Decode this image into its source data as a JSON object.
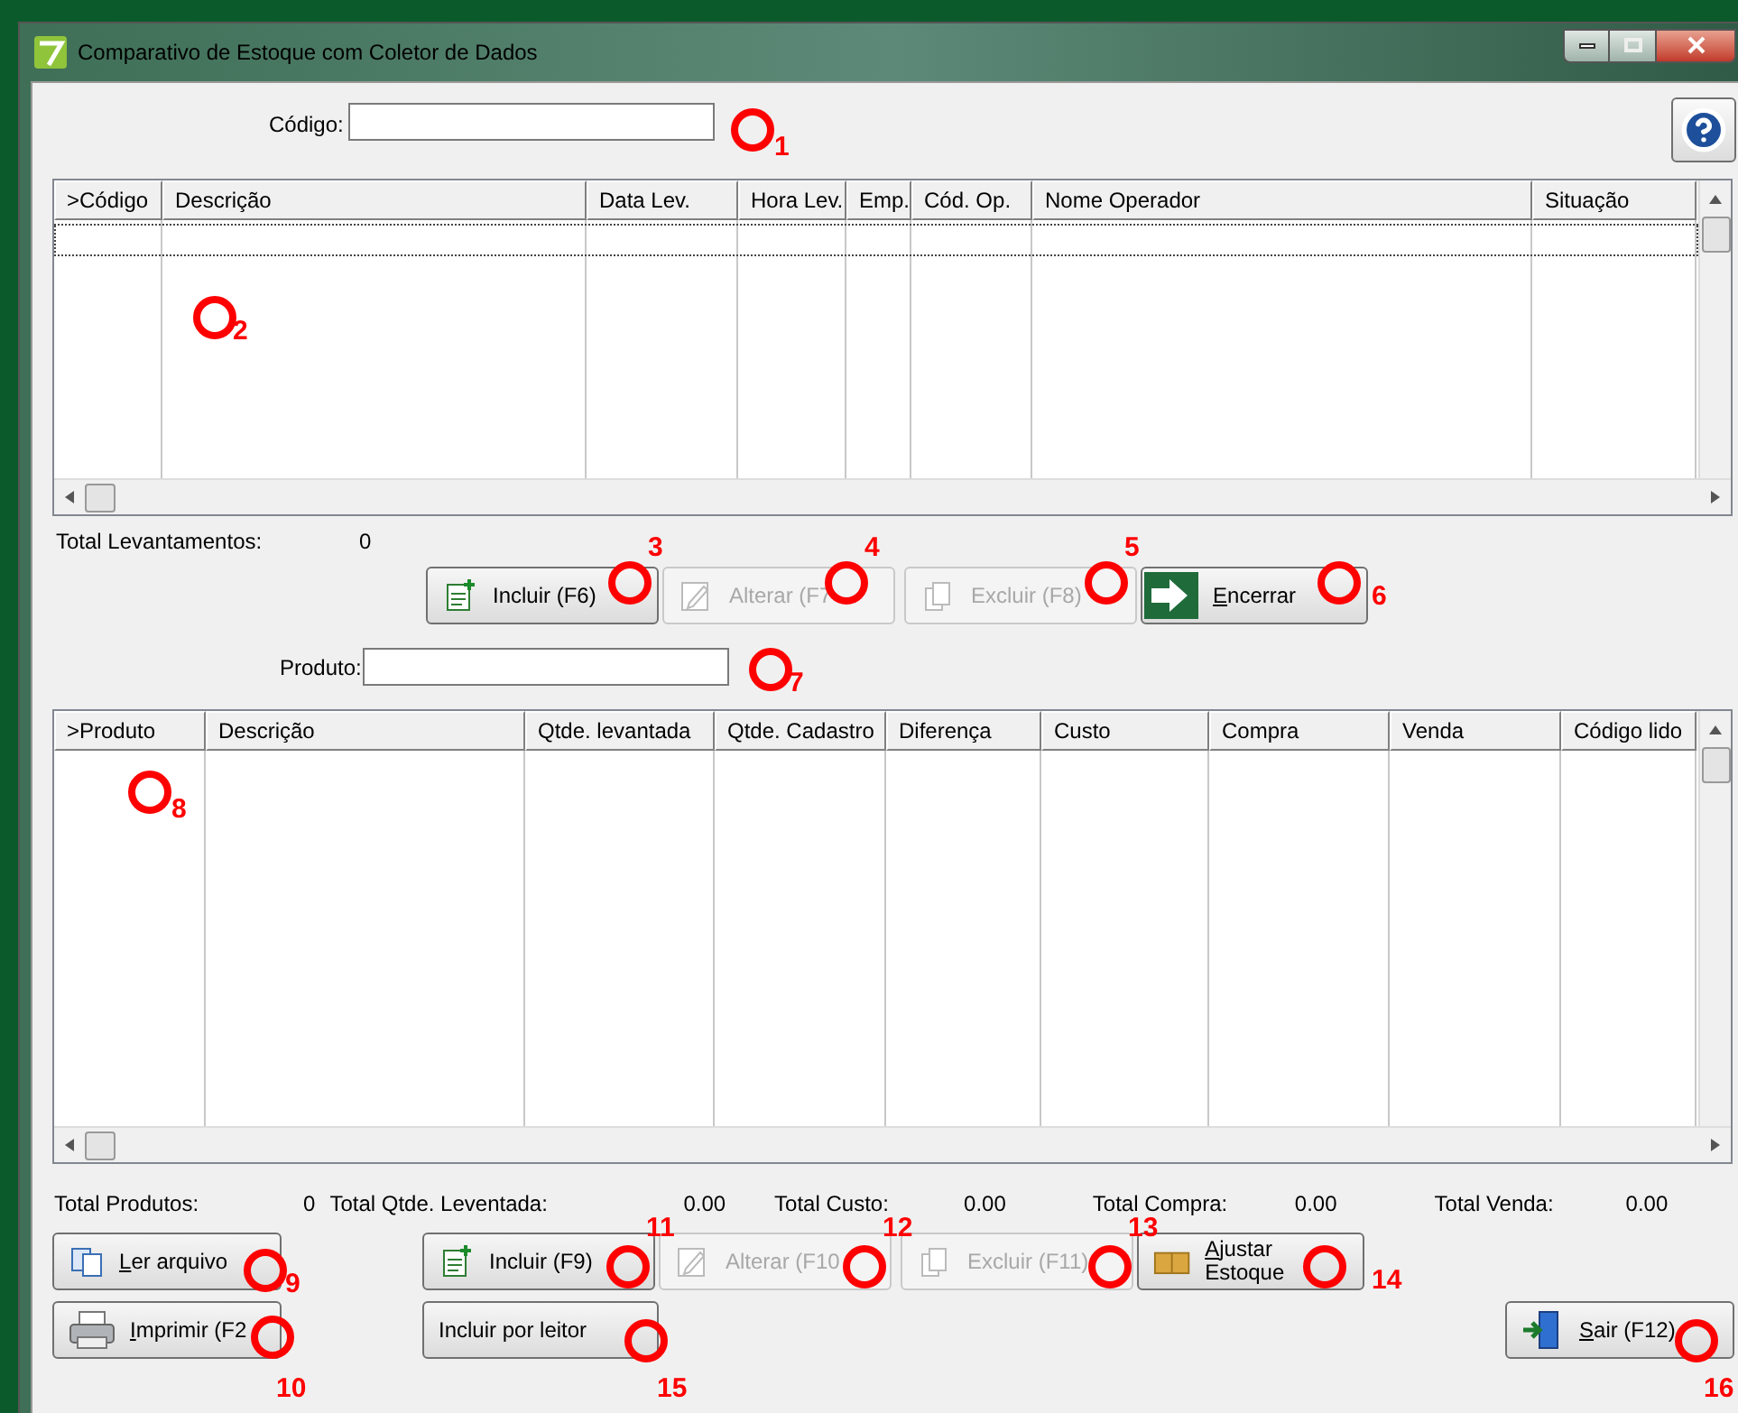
{
  "window": {
    "title": "Comparativo de Estoque com Coletor de Dados"
  },
  "codigo_field": {
    "label": "Código:"
  },
  "levantamentos_table": {
    "columns": [
      ">Código",
      "Descrição",
      "Data Lev.",
      "Hora Lev.",
      "Emp.",
      "Cód. Op.",
      "Nome Operador",
      "Situação"
    ]
  },
  "levantamentos_total": {
    "label": "Total Levantamentos:",
    "value": "0"
  },
  "levantamentos_buttons": [
    {
      "label": "Incluir (F6)",
      "disabled": false,
      "mnemonic": false
    },
    {
      "label": "Alterar (F7",
      "disabled": true,
      "mnemonic": false
    },
    {
      "label": "Excluir (F8)",
      "disabled": true,
      "mnemonic": false
    },
    {
      "label": "Encerrar",
      "disabled": false,
      "mnemonic": true
    }
  ],
  "produto_field": {
    "label": "Produto:"
  },
  "produtos_table": {
    "columns": [
      ">Produto",
      "Descrição",
      "Qtde. levantada",
      "Qtde. Cadastro",
      "Diferença",
      "Custo",
      "Compra",
      "Venda",
      "Código lido"
    ]
  },
  "totals": [
    {
      "label": "Total Produtos:",
      "value": "0"
    },
    {
      "label": "Total Qtde. Leventada:",
      "value": "0.00"
    },
    {
      "label": "Total Custo:",
      "value": "0.00"
    },
    {
      "label": "Total Compra:",
      "value": "0.00"
    },
    {
      "label": "Total Venda:",
      "value": "0.00"
    }
  ],
  "bottom_buttons": [
    {
      "label": "Ler arquivo",
      "disabled": false,
      "mnemonic": true
    },
    {
      "label": "Incluir (F9)",
      "disabled": false,
      "mnemonic": false
    },
    {
      "label": "Alterar (F10",
      "disabled": true,
      "mnemonic": false
    },
    {
      "label": "Excluir (F11)",
      "disabled": true,
      "mnemonic": false
    },
    {
      "label": "Ajustar Estoque",
      "disabled": false,
      "mnemonic": true
    },
    {
      "label": "Imprimir (F2",
      "disabled": false,
      "mnemonic": true
    },
    {
      "label": "Incluir por leitor",
      "disabled": false,
      "mnemonic": false
    },
    {
      "label": "Sair (F12)",
      "disabled": false,
      "mnemonic": true
    }
  ],
  "callouts": [
    {
      "label": "1"
    },
    {
      "label": "2"
    },
    {
      "label": "3"
    },
    {
      "label": "4"
    },
    {
      "label": "5"
    },
    {
      "label": "6"
    },
    {
      "label": "7"
    },
    {
      "label": "8"
    },
    {
      "label": "9"
    },
    {
      "label": "10"
    },
    {
      "label": "11"
    },
    {
      "label": "12"
    },
    {
      "label": "13"
    },
    {
      "label": "14"
    },
    {
      "label": "15"
    },
    {
      "label": "16"
    }
  ]
}
